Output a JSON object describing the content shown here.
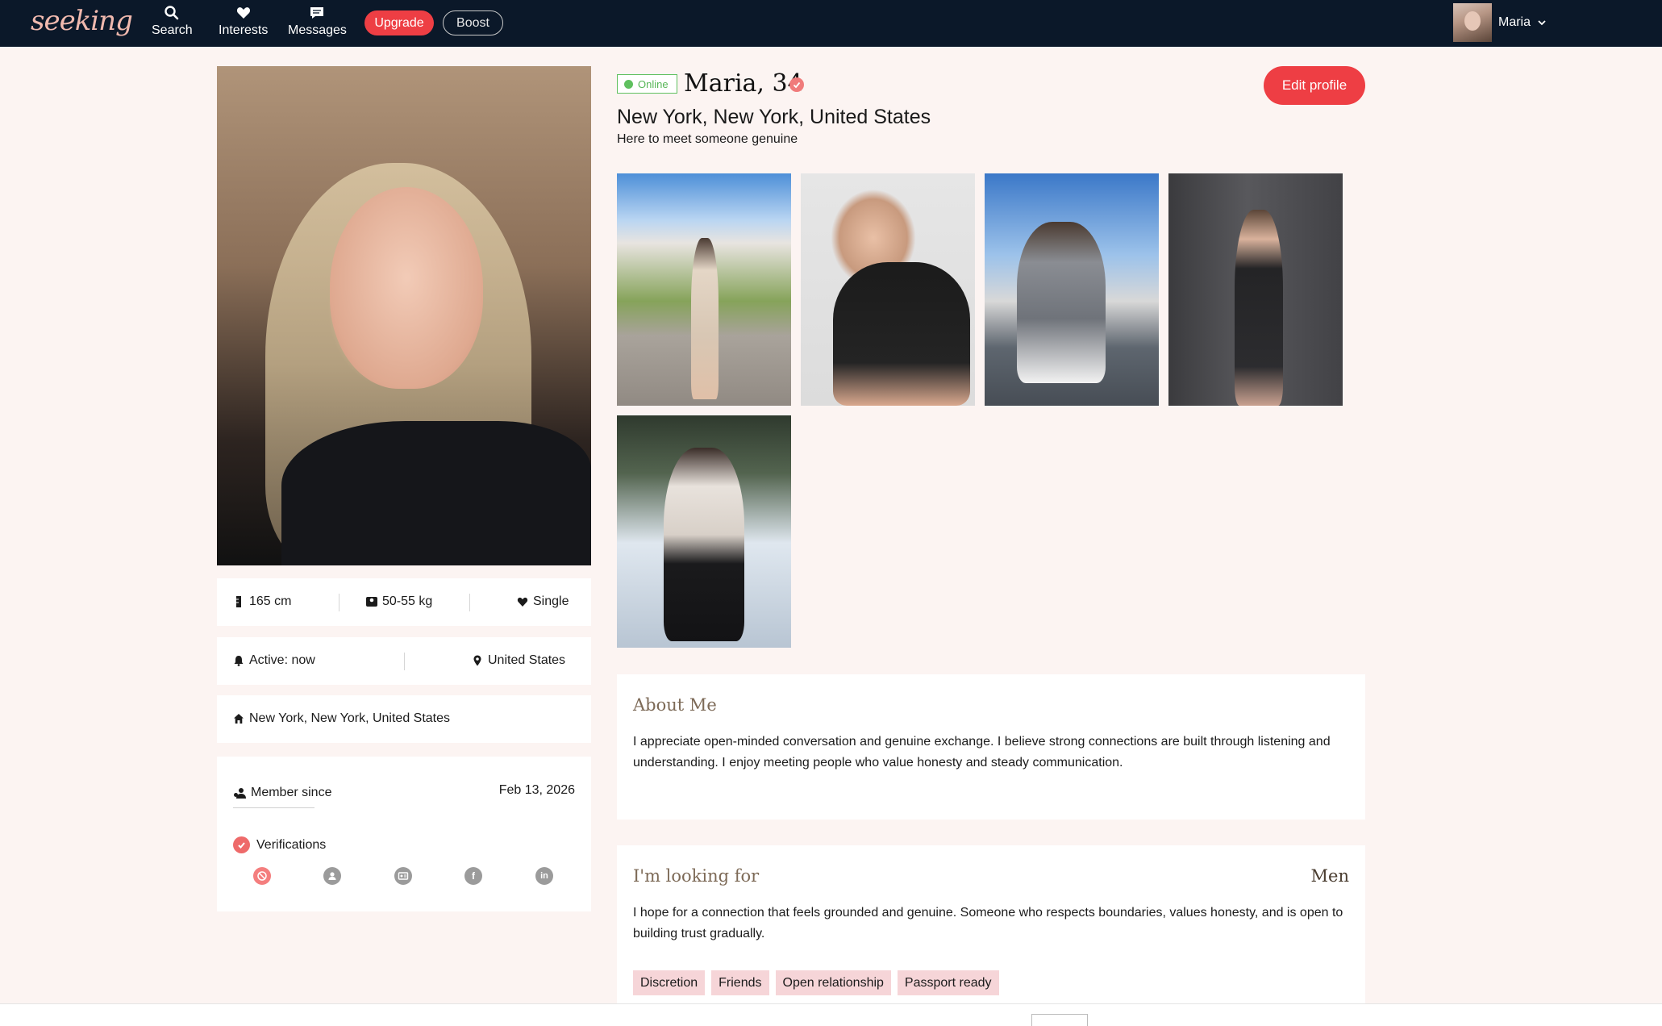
{
  "app": {
    "logo_text": "seeking"
  },
  "nav": {
    "items": [
      {
        "label": "Search",
        "icon": "search-icon"
      },
      {
        "label": "Interests",
        "icon": "heart-icon"
      },
      {
        "label": "Messages",
        "icon": "chat-icon"
      }
    ],
    "upgrade_label": "Upgrade",
    "boost_label": "Boost",
    "user_name": "Maria"
  },
  "profile": {
    "status": "Online",
    "name_age": "Maria, 34",
    "location": "New York, New York, United States",
    "tagline": "Here to meet someone genuine",
    "edit_label": "Edit profile",
    "height": "165 cm",
    "weight": "50-55 kg",
    "relationship": "Single",
    "active": "Active: now",
    "country": "United States",
    "home": "New York, New York, United States",
    "member_since_label": "Member since",
    "member_since_date": "Feb 13, 2026",
    "verifications_label": "Verifications",
    "verifications": [
      {
        "icon": "photo-verify-icon",
        "verified": true
      },
      {
        "icon": "profile-verify-icon",
        "verified": false
      },
      {
        "icon": "id-verify-icon",
        "verified": false
      },
      {
        "icon": "facebook-icon",
        "verified": false
      },
      {
        "icon": "linkedin-icon",
        "verified": false
      }
    ]
  },
  "about": {
    "title": "About Me",
    "body": "I appreciate open-minded conversation and genuine exchange. I believe strong connections are built through listening and understanding. I enjoy meeting people who value honesty and steady communication."
  },
  "looking": {
    "title": "I'm looking for",
    "target": "Men",
    "body": "I hope for a connection that feels grounded and genuine. Someone who respects boundaries, values honesty, and is open to building trust gradually.",
    "tags": [
      "Discretion",
      "Friends",
      "Open relationship",
      "Passport ready"
    ]
  },
  "colors": {
    "accent": "#ee3e44",
    "nav_bg": "#0b1829",
    "page_bg": "#fcf4f2",
    "online": "#5fc05f",
    "tag_bg": "#f6d5d8"
  }
}
